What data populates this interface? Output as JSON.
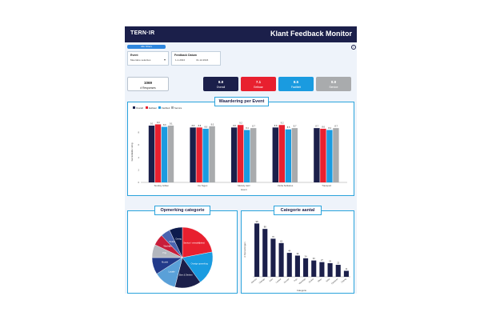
{
  "header": {
    "logo": "TERN·IR",
    "title": "Klant Feedback Monitor"
  },
  "filters": {
    "button_label": "Alle Filters",
    "event": {
      "label": "Event",
      "value": "Meerdere selecties"
    },
    "date": {
      "label": "Feedback Datum",
      "from": "1-1-2024",
      "to": "31-12-2024"
    }
  },
  "kpis": [
    {
      "value": "1069",
      "label": "# Responses"
    },
    {
      "value": "8.8",
      "label": "Overall"
    },
    {
      "value": "7.1",
      "label": "Eetbaar"
    },
    {
      "value": "8.5",
      "label": "Faciliteit"
    },
    {
      "value": "8.8",
      "label": "Service"
    }
  ],
  "colors": {
    "navy": "#1b1f4a",
    "red": "#e8202f",
    "blue": "#1a9be0",
    "grey": "#a9abad",
    "header": "#1b1f4a"
  },
  "panels": {
    "waardering_title": "Waardering per Event",
    "opmerking_title": "Opmerking categorie",
    "categorie_title": "Categorie aantal"
  },
  "chart_data": [
    {
      "type": "bar",
      "title": "Waardering per Event",
      "xlabel": "Event",
      "ylabel": "Gemiddelde rating",
      "legend": [
        "Overall",
        "Eetbaar",
        "Faciliteit",
        "Service"
      ],
      "categories": [
        "Sunday Grillen",
        "De Tegen",
        "Melody Jazz",
        "Vieha Solitaires",
        "Transport"
      ],
      "ylim": [
        0,
        10
      ],
      "series": [
        {
          "name": "Overall",
          "values": [
            9.1,
            8.8,
            8.8,
            8.8,
            8.7
          ]
        },
        {
          "name": "Eetbaar",
          "values": [
            9.3,
            8.8,
            9.2,
            9.2,
            8.6
          ]
        },
        {
          "name": "Faciliteit",
          "values": [
            8.9,
            8.6,
            8.4,
            8.5,
            8.4
          ]
        },
        {
          "name": "Service",
          "values": [
            9.1,
            9.0,
            8.7,
            8.7,
            8.7
          ]
        }
      ]
    },
    {
      "type": "pie",
      "title": "Opmerking categorie",
      "slices": [
        {
          "label": "Service / vriendelijkheid",
          "value": 22
        },
        {
          "label": "Overige opmerking",
          "value": 18
        },
        {
          "label": "Eten & Drinken",
          "value": 14
        },
        {
          "label": "Locatie",
          "value": 12
        },
        {
          "label": "Muziek",
          "value": 9
        },
        {
          "label": "Prijs",
          "value": 7
        },
        {
          "label": "Wachttijd",
          "value": 6
        },
        {
          "label": "Drukte",
          "value": 5
        },
        {
          "label": "Overig",
          "value": 7
        }
      ]
    },
    {
      "type": "bar",
      "title": "Categorie aantal",
      "xlabel": "Categorie",
      "ylabel": "# Opmerkingen",
      "categories": [
        "Service",
        "Overige",
        "Eten",
        "Locatie",
        "Muziek",
        "Prijs",
        "Wachttijd",
        "Drukte",
        "Sfeer",
        "Toilet",
        "Parkeren",
        "Overig"
      ],
      "values": [
        98,
        88,
        70,
        62,
        44,
        39,
        34,
        30,
        27,
        25,
        22,
        11
      ]
    }
  ]
}
